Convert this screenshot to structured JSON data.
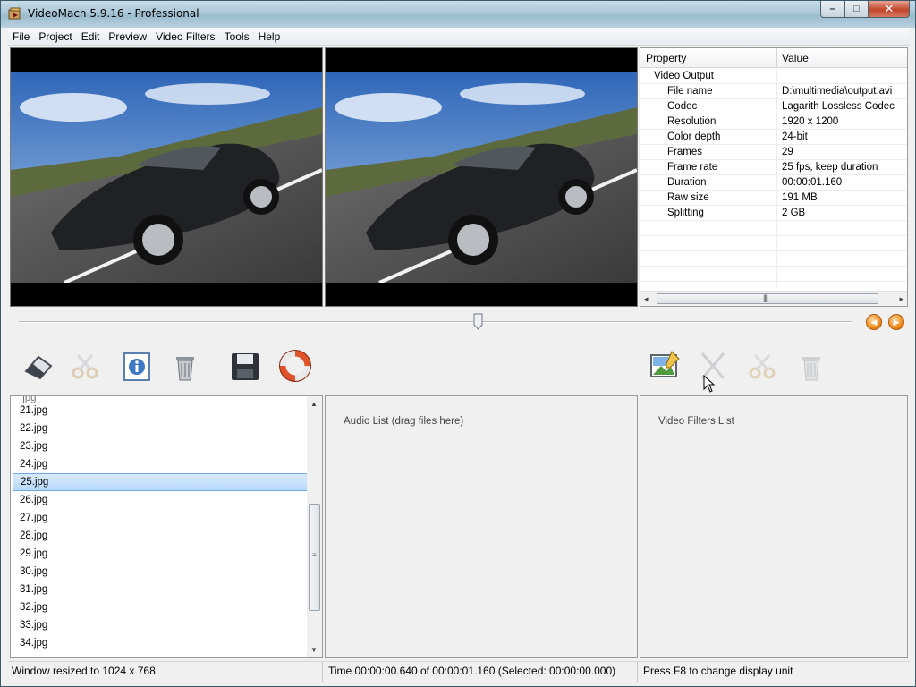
{
  "window": {
    "title": "VideoMach 5.9.16 - Professional",
    "minimize_glyph": "–",
    "maximize_glyph": "□",
    "close_glyph": "✕"
  },
  "menu": [
    {
      "label": "File"
    },
    {
      "label": "Project"
    },
    {
      "label": "Edit"
    },
    {
      "label": "Preview"
    },
    {
      "label": "Video Filters"
    },
    {
      "label": "Tools"
    },
    {
      "label": "Help"
    }
  ],
  "properties": {
    "col_property": "Property",
    "col_value": "Value",
    "group": "Video Output",
    "rows": [
      {
        "key": "File name",
        "value": "D:\\multimedia\\output.avi"
      },
      {
        "key": "Codec",
        "value": "Lagarith Lossless Codec"
      },
      {
        "key": "Resolution",
        "value": "1920 x 1200"
      },
      {
        "key": "Color depth",
        "value": "24-bit"
      },
      {
        "key": "Frames",
        "value": "29"
      },
      {
        "key": "Frame rate",
        "value": "25 fps, keep duration"
      },
      {
        "key": "Duration",
        "value": "00:00:01.160"
      },
      {
        "key": "Raw size",
        "value": "191 MB"
      },
      {
        "key": "Splitting",
        "value": "2 GB"
      }
    ],
    "scroll_left": "◂",
    "scroll_right": "▸",
    "scroll_grip": "|||"
  },
  "timeline": {
    "position_fraction": 0.55,
    "prev_glyph": "◀",
    "next_glyph": "▶"
  },
  "toolbar_left": [
    {
      "icon": "eraser-icon",
      "enabled": true
    },
    {
      "icon": "scissors-icon",
      "enabled": false
    },
    {
      "icon": "info-icon",
      "enabled": true
    },
    {
      "icon": "trash-icon",
      "enabled": true
    },
    {
      "icon": "save-icon",
      "enabled": true
    },
    {
      "icon": "lifebuoy-icon",
      "enabled": true
    }
  ],
  "toolbar_right": [
    {
      "icon": "edit-image-icon",
      "enabled": true
    },
    {
      "icon": "cut-icon",
      "enabled": false
    },
    {
      "icon": "scissors-icon",
      "enabled": false
    },
    {
      "icon": "trash-icon",
      "enabled": false
    }
  ],
  "video_list": {
    "items": [
      "21.jpg",
      "22.jpg",
      "23.jpg",
      "24.jpg",
      "25.jpg",
      "26.jpg",
      "27.jpg",
      "28.jpg",
      "29.jpg",
      "30.jpg",
      "31.jpg",
      "32.jpg",
      "33.jpg",
      "34.jpg"
    ],
    "selected": "25.jpg",
    "scroll_up": "▲",
    "scroll_down": "▼"
  },
  "audio_list": {
    "hint": "Audio List (drag files here)"
  },
  "filters_list": {
    "hint": "Video Filters List"
  },
  "status": {
    "left": "Window resized to 1024 x 768",
    "middle": "Time 00:00:00.640 of 00:00:01.160  (Selected: 00:00:00.000)",
    "right": "Press F8 to change display unit"
  },
  "colors": {
    "selection": "#b8d8fb",
    "accent_orange": "#f08a1a"
  }
}
